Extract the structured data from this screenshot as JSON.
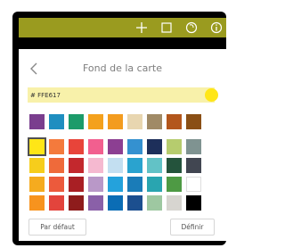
{
  "toolbar": {
    "icons": [
      "plus-icon",
      "square-icon",
      "palette-icon",
      "info-icon"
    ],
    "background_color": "#9a9b1f"
  },
  "panel": {
    "title": "Fond de la carte",
    "back_icon": "chevron-left-icon"
  },
  "hex": {
    "value": "# FFE617",
    "swatch_color": "#FFE617",
    "field_background": "#f8f1aa"
  },
  "recent_colors": [
    "#7a3e8e",
    "#1f8ec0",
    "#1c9b6a",
    "#f4a11d",
    "#f39c1f",
    "#e8d6b0",
    "#a08a66",
    "#b3561c",
    "#8a4f15"
  ],
  "palette_rows": [
    [
      "#ffe617",
      "#f47a3c",
      "#e8443a",
      "#f25f8f",
      "#8c3f92",
      "#3491d0",
      "#1d2f5a",
      "#b6cc6e",
      "#7f9391"
    ],
    [
      "#f6cd1c",
      "#ef6a3a",
      "#c3282d",
      "#f5b9d0",
      "#c3dff1",
      "#2aa3cf",
      "#62c2c6",
      "#24533c",
      "#414651"
    ],
    [
      "#f5ab1f",
      "#ec5a3c",
      "#a91f24",
      "#b998c8",
      "#24a2dc",
      "#1a7cb8",
      "#29a5b0",
      "#4e9a44",
      "#ffffff"
    ],
    [
      "#f7931e",
      "#e3443c",
      "#8e1c1c",
      "#8a60a8",
      "#0b6db5",
      "#1c4f8f",
      "#9ec8a1",
      "#d7d5d0",
      "#000000"
    ]
  ],
  "selected_swatch": "#ffe617",
  "buttons": {
    "default_label": "Par défaut",
    "apply_label": "Définir"
  }
}
